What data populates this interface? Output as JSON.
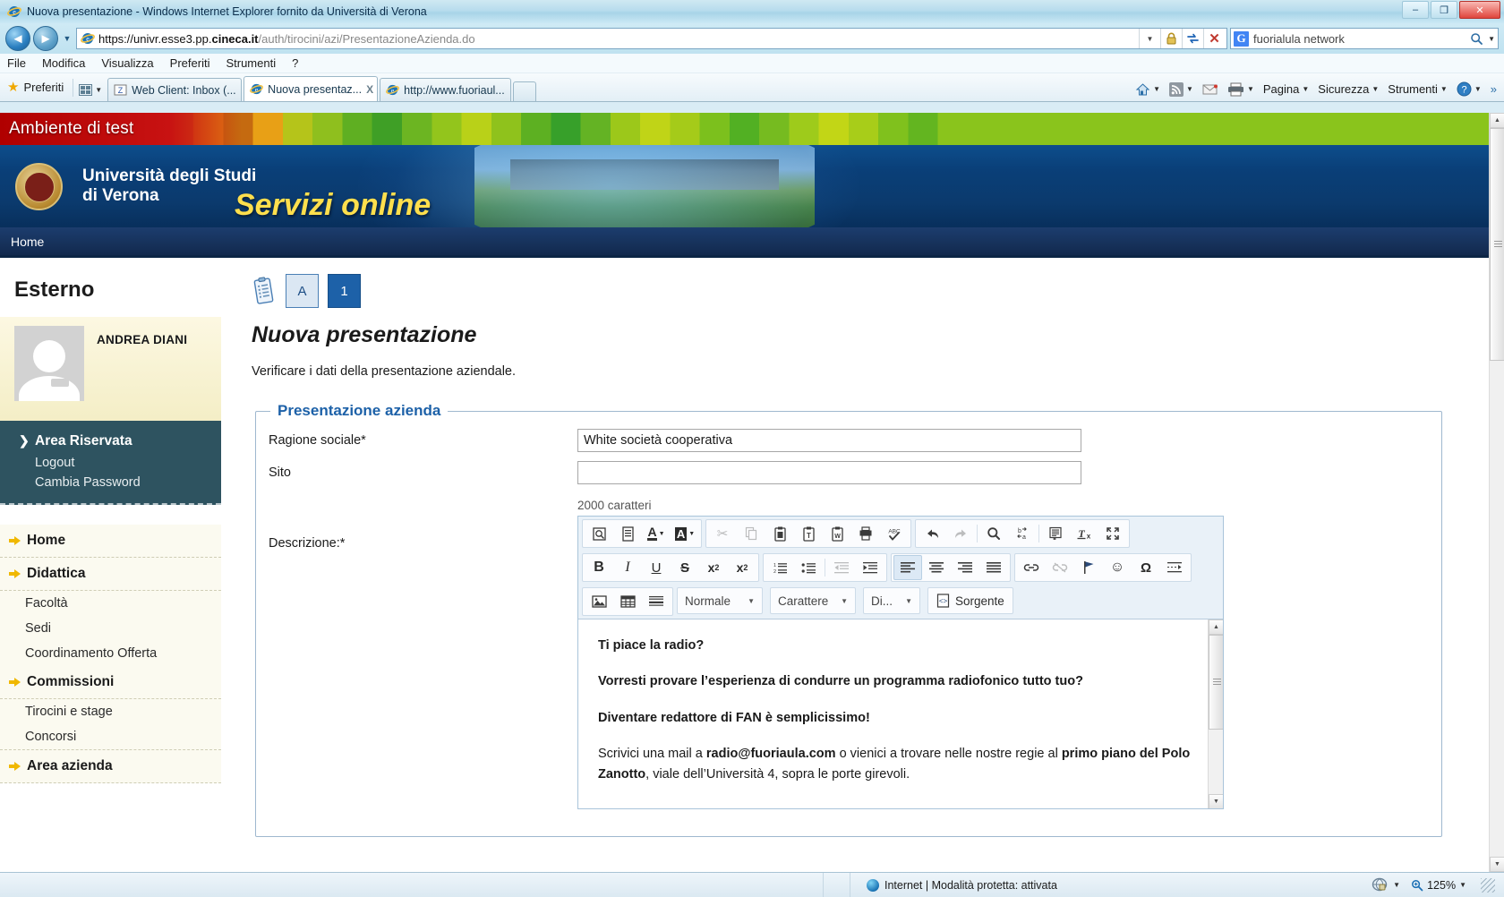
{
  "window": {
    "title": "Nuova presentazione - Windows Internet Explorer fornito da Università di Verona",
    "minimize_label": "–",
    "maximize_label": "❐",
    "close_label": "✕"
  },
  "address_bar": {
    "url_scheme": "https://",
    "url_host_pre": "univr.esse3.pp.",
    "url_domain": "cineca.it",
    "url_path": "/auth/tirocini/azi/PresentazioneAzienda.do",
    "back_label": "◄",
    "forward_label": "►",
    "history_caret": "▼",
    "url_dropdown": "▼",
    "lock_icon": "lock-icon",
    "compat_icon": "compatibility-view-icon",
    "stop_label": "✕",
    "search_provider": "G",
    "search_value": "fuorialula network",
    "search_icon": "search-icon",
    "search_caret": "▼"
  },
  "menubar": {
    "items": [
      "File",
      "Modifica",
      "Visualizza",
      "Preferiti",
      "Strumenti",
      "?"
    ]
  },
  "tabbar": {
    "favorites_label": "Preferiti",
    "tabs": [
      {
        "label": "Web Client: Inbox (...",
        "active": false,
        "closable": false
      },
      {
        "label": "Nuova presentaz...",
        "active": true,
        "closable": true,
        "close_label": "X"
      },
      {
        "label": "http://www.fuoriaul...",
        "active": false,
        "closable": false
      }
    ],
    "command_items": [
      "Pagina",
      "Sicurezza",
      "Strumenti"
    ],
    "caret": "▼"
  },
  "test_banner": {
    "label": "Ambiente di test"
  },
  "site_header": {
    "university_line1": "Università degli Studi",
    "university_line2": "di Verona",
    "service_title": "Servizi online",
    "nav_home": "Home"
  },
  "sidebar": {
    "title": "Esterno",
    "user_name": "ANDREA DIANI",
    "reserved_area": {
      "heading": "Area Riservata",
      "items": [
        "Logout",
        "Cambia Password"
      ]
    },
    "groups": [
      {
        "heading": "Home",
        "items": []
      },
      {
        "heading": "Didattica",
        "items": [
          "Facoltà",
          "Sedi",
          "Coordinamento Offerta"
        ]
      },
      {
        "heading": "Commissioni",
        "items": [
          "Tirocini e stage",
          "Concorsi"
        ]
      },
      {
        "heading": "Area azienda",
        "items": []
      }
    ]
  },
  "main": {
    "steps": [
      {
        "label": "A",
        "state": "done"
      },
      {
        "label": "1",
        "state": "current"
      }
    ],
    "clipboard_icon": "clipboard-icon",
    "page_title": "Nuova presentazione",
    "lead": "Verificare i dati della presentazione aziendale.",
    "fieldset_legend": "Presentazione azienda",
    "fields": [
      {
        "label": "Ragione sociale*",
        "value": "White società cooperativa",
        "placeholder": ""
      },
      {
        "label": "Sito",
        "value": "",
        "placeholder": ""
      }
    ],
    "description_label": "Descrizione:*",
    "char_note": "2000 caratteri"
  },
  "editor": {
    "toolbar_row1": [
      {
        "name": "preview-icon",
        "glyph": "⎙"
      },
      {
        "name": "templates-icon",
        "glyph": "▤"
      },
      {
        "name": "text-color-icon",
        "glyph": "A"
      },
      {
        "name": "background-color-icon",
        "glyph": "A"
      }
    ],
    "toolbar_row1b": [
      {
        "name": "cut-icon",
        "glyph": "✂",
        "disabled": true
      },
      {
        "name": "copy-icon",
        "glyph": "❐",
        "disabled": true
      },
      {
        "name": "paste-icon",
        "glyph": "📋"
      },
      {
        "name": "paste-as-text-icon",
        "glyph": "T"
      },
      {
        "name": "paste-from-word-icon",
        "glyph": "W"
      },
      {
        "name": "print-icon",
        "glyph": "🖶"
      },
      {
        "name": "spellcheck-icon",
        "glyph": "ABC"
      }
    ],
    "toolbar_row1c": [
      {
        "name": "undo-icon",
        "glyph": "↩"
      },
      {
        "name": "redo-icon",
        "glyph": "↪",
        "disabled": true
      },
      {
        "name": "find-icon",
        "glyph": "🔍"
      },
      {
        "name": "replace-icon",
        "glyph": "ba"
      },
      {
        "name": "select-all-icon",
        "glyph": "▤"
      },
      {
        "name": "remove-format-icon",
        "glyph": "Tx"
      },
      {
        "name": "maximize-icon",
        "glyph": "⤢"
      }
    ],
    "toolbar_row2": [
      {
        "name": "bold-icon",
        "glyph": "B"
      },
      {
        "name": "italic-icon",
        "glyph": "I"
      },
      {
        "name": "underline-icon",
        "glyph": "U"
      },
      {
        "name": "strikethrough-icon",
        "glyph": "S"
      },
      {
        "name": "subscript-icon",
        "glyph": "x₂"
      },
      {
        "name": "superscript-icon",
        "glyph": "x²"
      }
    ],
    "toolbar_row2b": [
      {
        "name": "numbered-list-icon",
        "glyph": "1≡"
      },
      {
        "name": "bulleted-list-icon",
        "glyph": "•≡"
      },
      {
        "name": "decrease-indent-icon",
        "glyph": "⇤",
        "disabled": true
      },
      {
        "name": "increase-indent-icon",
        "glyph": "⇥"
      }
    ],
    "toolbar_row2c": [
      {
        "name": "align-left-icon",
        "glyph": "≡",
        "active": true
      },
      {
        "name": "align-center-icon",
        "glyph": "≡"
      },
      {
        "name": "align-right-icon",
        "glyph": "≡"
      },
      {
        "name": "align-justify-icon",
        "glyph": "≡"
      }
    ],
    "toolbar_row2d": [
      {
        "name": "link-icon",
        "glyph": "🔗"
      },
      {
        "name": "unlink-icon",
        "glyph": "🔗",
        "disabled": true
      },
      {
        "name": "anchor-icon",
        "glyph": "⚑"
      },
      {
        "name": "smiley-icon",
        "glyph": "☺"
      },
      {
        "name": "special-char-icon",
        "glyph": "Ω"
      },
      {
        "name": "page-break-icon",
        "glyph": "⇥"
      }
    ],
    "toolbar_row3": [
      {
        "name": "image-icon",
        "glyph": "▣"
      },
      {
        "name": "table-icon",
        "glyph": "⊞"
      },
      {
        "name": "horizontal-rule-icon",
        "glyph": "≡"
      }
    ],
    "combo_format": "Normale",
    "combo_font": "Carattere",
    "combo_size": "Di...",
    "source_button": "Sorgente",
    "source_icon": "source-icon",
    "content": [
      {
        "html": "<b>Ti piace la radio?</b>"
      },
      {
        "html": "<b>Vorresti provare l’esperienza di condurre un programma radiofonico tutto tuo?</b>"
      },
      {
        "html": "<b>Diventare redattore di FAN è semplicissimo!</b>"
      },
      {
        "html": "Scrivici una mail a <b>radio@fuoriaula.com</b> o vienici a trovare nelle nostre regie al <b>primo piano del Polo Zanotto</b>, viale dell’Università 4, sopra le porte girevoli."
      }
    ],
    "scroll_up": "▲",
    "scroll_down": "▼"
  },
  "statusbar": {
    "zone_text": "Internet | Modalità protetta: attivata",
    "zone_icon": "globe-icon",
    "zoom_level": "125%",
    "zoom_icon": "zoom-icon",
    "zoom_caret": "▼",
    "privacy_icon": "privacy-report-icon",
    "privacy_caret": "▼"
  },
  "colors": {
    "accent_blue": "#1d61a8",
    "header_blue": "#0b3a6d",
    "sidebar_teal": "#2e5360",
    "test_red": "#b50000",
    "highlight_yellow": "#ffdf4d"
  }
}
